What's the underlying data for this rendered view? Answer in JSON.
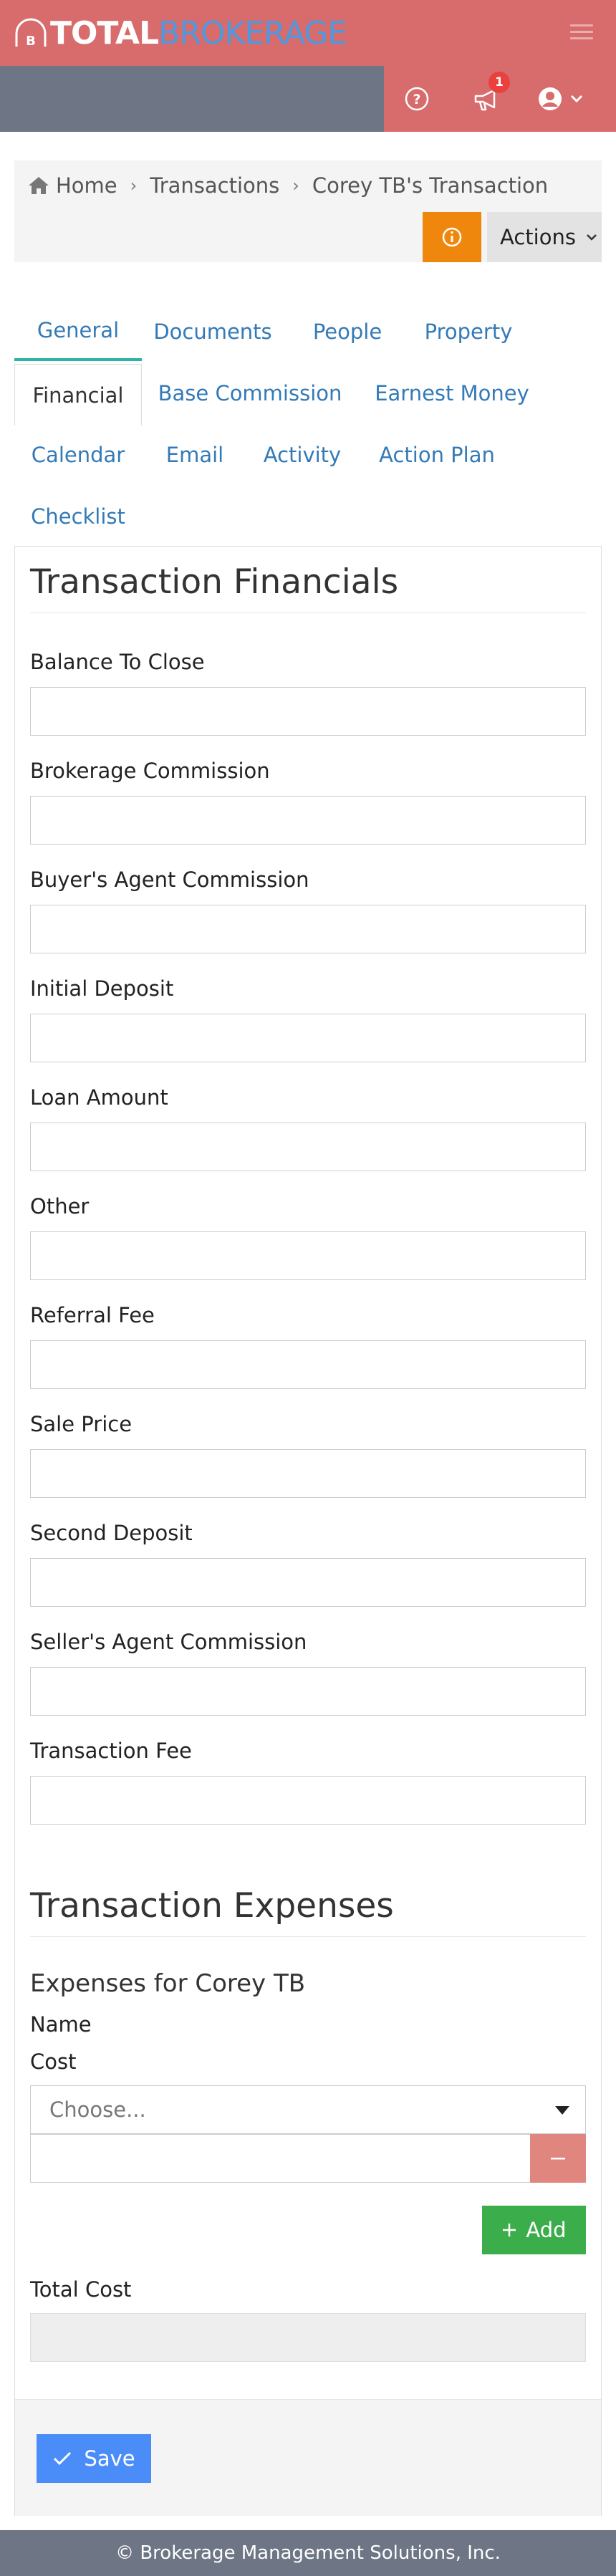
{
  "app": {
    "logo_total": "TOTAL",
    "logo_brokerage": "BROKERAGE",
    "logo_badge_letter": "B",
    "colors": {
      "header": "#d86b6c",
      "subheader": "#6e7584",
      "accent_link": "#337ab7",
      "tab_underline": "#2bb3a8",
      "warning": "#f0870d",
      "success": "#3cad4b",
      "primary": "#4b8df8",
      "danger": "#e0867f",
      "badge": "#e8413e"
    }
  },
  "header": {
    "icons": [
      "hamburger-menu-icon",
      "help-circle-icon",
      "megaphone-icon",
      "user-circle-icon",
      "chevron-down-icon"
    ],
    "notification_count": "1"
  },
  "breadcrumb": {
    "home": "Home",
    "transactions": "Transactions",
    "current": "Corey TB's Transaction"
  },
  "toolbar": {
    "actions_label": "Actions"
  },
  "tabs": [
    {
      "label": "General"
    },
    {
      "label": "Documents"
    },
    {
      "label": "People"
    },
    {
      "label": "Property"
    },
    {
      "label": "Financial"
    },
    {
      "label": "Base Commission"
    },
    {
      "label": "Earnest Money"
    },
    {
      "label": "Calendar"
    },
    {
      "label": "Email"
    },
    {
      "label": "Activity"
    },
    {
      "label": "Action Plan"
    },
    {
      "label": "Checklist"
    }
  ],
  "financials": {
    "title": "Transaction Financials",
    "fields": [
      {
        "label": "Balance To Close",
        "value": ""
      },
      {
        "label": "Brokerage Commission",
        "value": ""
      },
      {
        "label": "Buyer's Agent Commission",
        "value": ""
      },
      {
        "label": "Initial Deposit",
        "value": ""
      },
      {
        "label": "Loan Amount",
        "value": ""
      },
      {
        "label": "Other",
        "value": ""
      },
      {
        "label": "Referral Fee",
        "value": ""
      },
      {
        "label": "Sale Price",
        "value": ""
      },
      {
        "label": "Second Deposit",
        "value": ""
      },
      {
        "label": "Seller's Agent Commission",
        "value": ""
      },
      {
        "label": "Transaction Fee",
        "value": ""
      }
    ]
  },
  "expenses": {
    "title": "Transaction Expenses",
    "subtitle": "Expenses for Corey TB",
    "name_label": "Name",
    "cost_label": "Cost",
    "select_placeholder": "Choose...",
    "cost_value": "",
    "add_label": "Add",
    "total_label": "Total Cost",
    "total_value": ""
  },
  "form": {
    "save_label": "Save"
  },
  "footer": {
    "copyright": "© Brokerage Management Solutions, Inc."
  }
}
